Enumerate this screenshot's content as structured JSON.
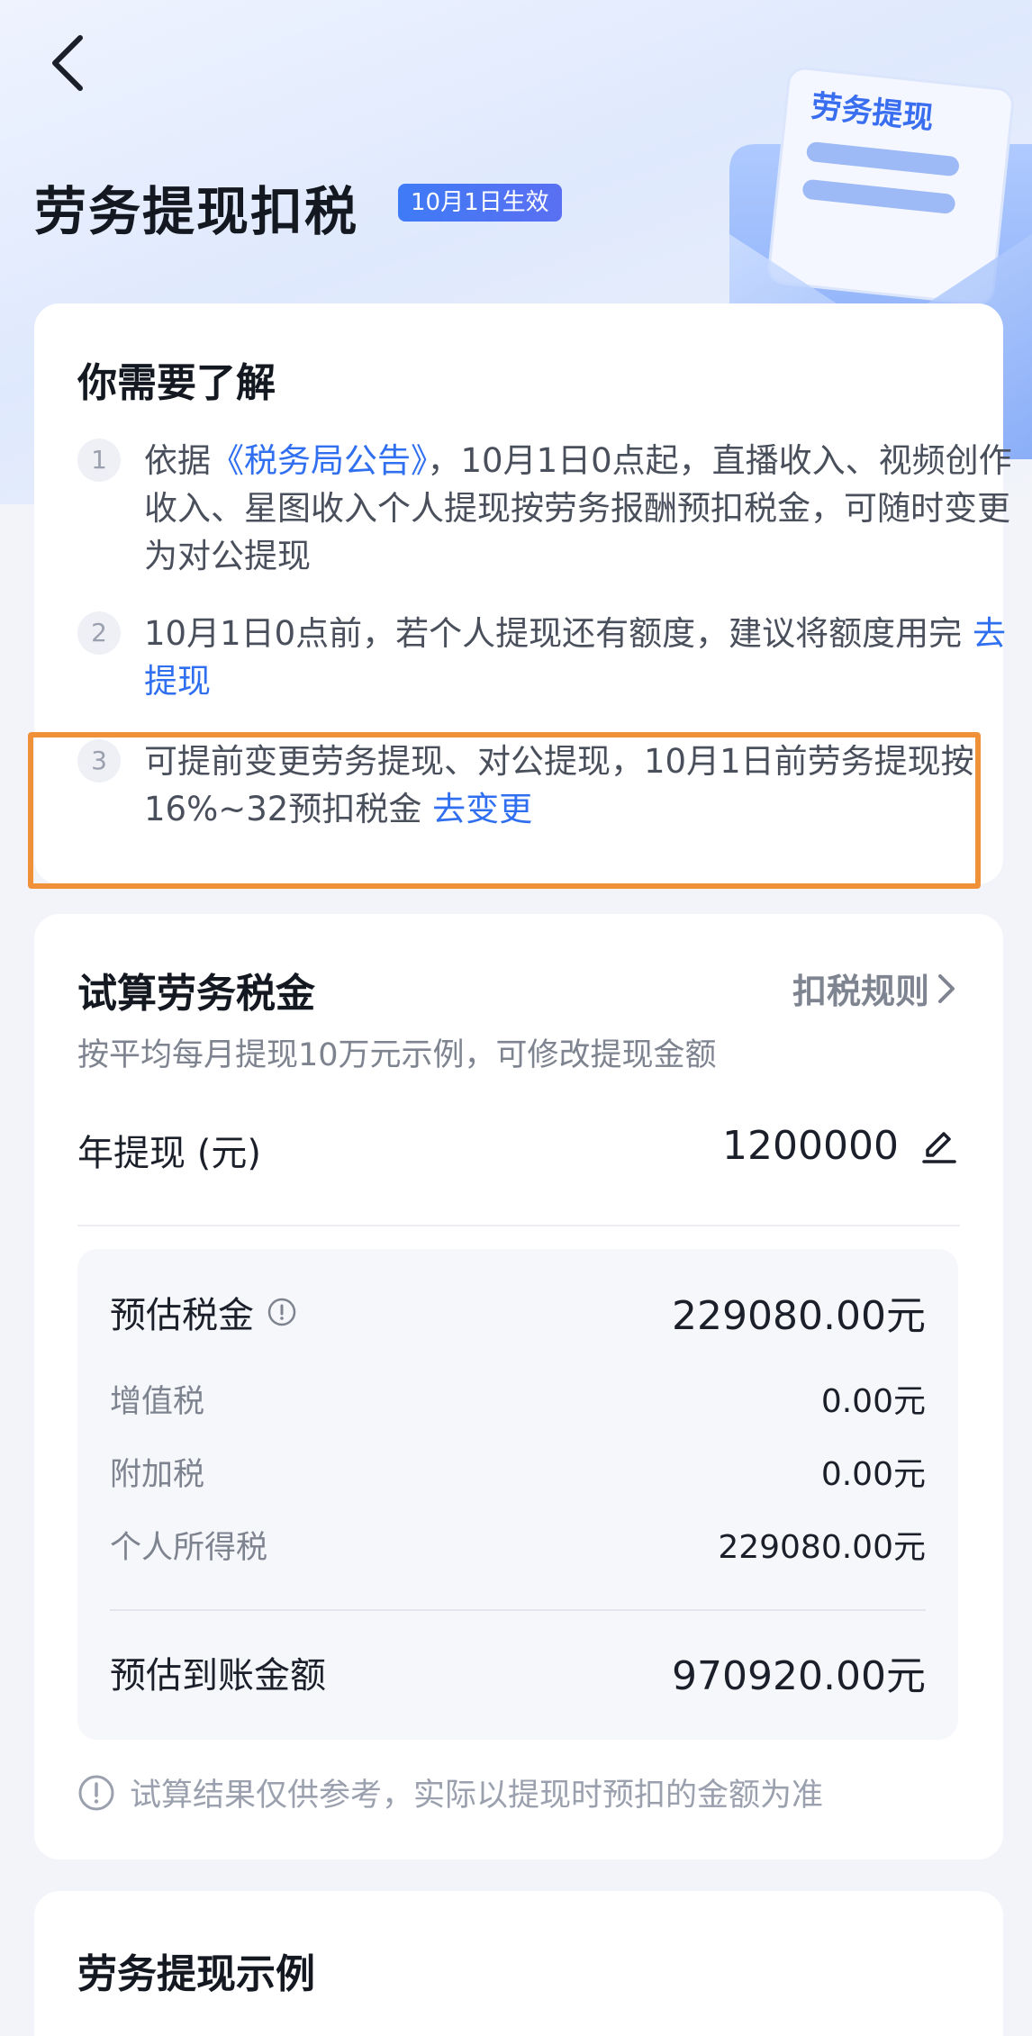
{
  "header": {
    "title": "劳务提现扣税",
    "badge": "10月1日生效",
    "illustration_label": "劳务提现"
  },
  "notice": {
    "title": "你需要了解",
    "items": [
      {
        "num": "1",
        "pre": "依据",
        "link": "《税务局公告》",
        "post": "，10月1日0点起，直播收入、视频创作收入、星图收入个人提现按劳务报酬预扣税金，可随时变更为对公提现"
      },
      {
        "num": "2",
        "pre": "10月1日0点前，若个人提现还有额度，建议将额度用完 ",
        "link": "去提现"
      },
      {
        "num": "3",
        "pre": "可提前变更劳务提现、对公提现，10月1日前劳务提现按16%~32预扣税金 ",
        "link": "去变更"
      }
    ]
  },
  "calculator": {
    "title": "试算劳务税金",
    "rules_link": "扣税规则",
    "subtitle": "按平均每月提现10万元示例，可修改提现金额",
    "annual_label": "年提现 (元)",
    "annual_value": "1200000",
    "estimated_tax_label": "预估税金",
    "estimated_tax_value": "229080.00元",
    "breakdown": [
      {
        "label": "增值税",
        "value": "0.00元"
      },
      {
        "label": "附加税",
        "value": "0.00元"
      },
      {
        "label": "个人所得税",
        "value": "229080.00元"
      }
    ],
    "net_label": "预估到账金额",
    "net_value": "970920.00元",
    "disclaimer": "试算结果仅供参考，实际以提现时预扣的金额为准"
  },
  "example": {
    "title": "劳务提现示例"
  },
  "colors": {
    "accent": "#2f6ff0",
    "highlight": "#f0913a",
    "badge": "#3f7bf6"
  }
}
